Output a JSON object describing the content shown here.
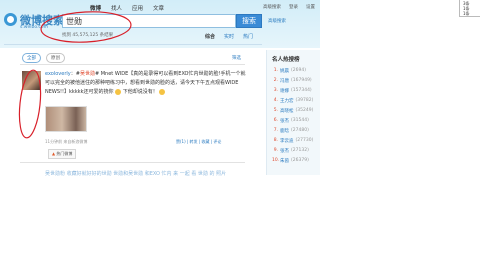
{
  "header": {
    "logo_text": "微博搜索",
    "logo_url": "s.weibo.com",
    "nav": [
      "微博",
      "找人",
      "应用",
      "文章"
    ],
    "links": [
      "高级搜索",
      "登录",
      "设置"
    ]
  },
  "search": {
    "query": "世勋",
    "button_label": "搜索",
    "advanced_label": "高级搜索",
    "result_count": "找到 45,575,125 条结果"
  },
  "filter_tabs": [
    "综合",
    "实时",
    "热门"
  ],
  "type_tabs": [
    "全部",
    "原创"
  ],
  "filter_link": "筛选",
  "feed": {
    "user": "exoloverly",
    "text_prefix": "：#",
    "highlight": "吴世勋",
    "text_body": "# Mnet WIDE【真的是录得可以看到EXO忙内世勋的脸!手机一个就可以完全的被他迷住的那种吧练习中，想看到世勋的脸的话，请今天下午五点观看WIDE NEWS!!】kkkkk还可爱的挠你",
    "text_suffix": "下他却说没有！",
    "time": "11分钟前 来自新浪微博",
    "actions": "赞(1) | 转发 | 收藏 | 评论",
    "tag": "热门微博"
  },
  "next_preview": "吴世勋粉 收藏好就好好的世勋 世勋和吴世勋 和EXO 忙内 来 一起 看 世勋 的 照片",
  "sidebar": {
    "title": "名人热搜榜",
    "items": [
      {
        "rank": "1.",
        "name": "姚晨",
        "count": "(2694)"
      },
      {
        "rank": "2.",
        "name": "冯唐",
        "count": "(167949)"
      },
      {
        "rank": "3.",
        "name": "谢娜",
        "count": "(157344)"
      },
      {
        "rank": "4.",
        "name": "王力宏",
        "count": "(39782)"
      },
      {
        "rank": "5.",
        "name": "高晓松",
        "count": "(35249)"
      },
      {
        "rank": "6.",
        "name": "张杰",
        "count": "(31544)"
      },
      {
        "rank": "7.",
        "name": "鹿晗",
        "count": "(27480)"
      },
      {
        "rank": "8.",
        "name": "李云迪",
        "count": "(27730)"
      },
      {
        "rank": "9.",
        "name": "张杰",
        "count": "(27132)"
      },
      {
        "rank": "10.",
        "name": "朱茵",
        "count": "(26379)"
      }
    ]
  },
  "popup": {
    "lines": [
      "3条",
      "1条",
      "1条"
    ]
  }
}
